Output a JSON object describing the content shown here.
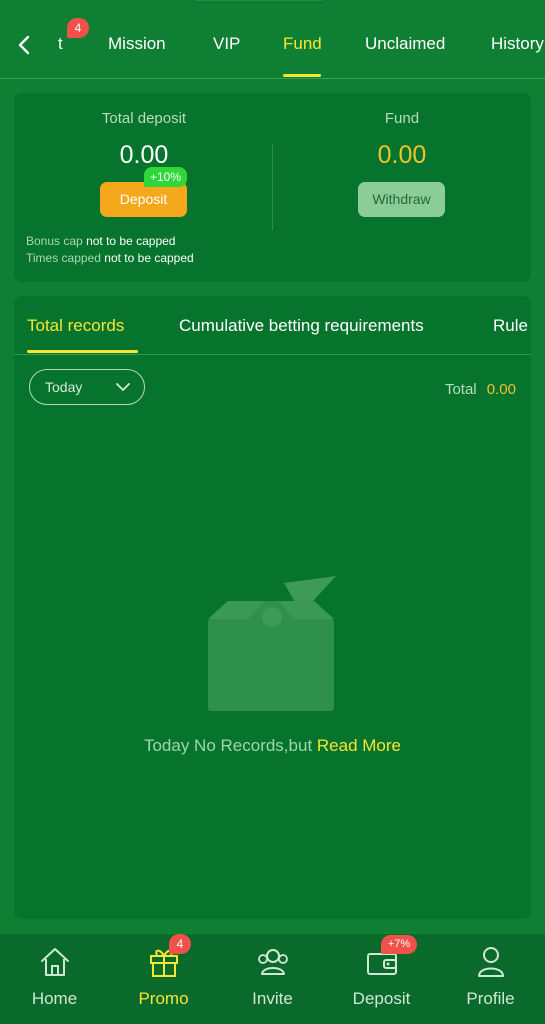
{
  "topbar": {
    "tabs": [
      {
        "label": "t",
        "badge": "4"
      },
      {
        "label": "Mission"
      },
      {
        "label": "VIP"
      },
      {
        "label": "Fund",
        "active": true
      },
      {
        "label": "Unclaimed"
      },
      {
        "label": "History"
      }
    ]
  },
  "summary": {
    "deposit_label": "Total deposit",
    "deposit_amount": "0.00",
    "deposit_button": "Deposit",
    "deposit_bonus": "+10%",
    "fund_label": "Fund",
    "fund_amount": "0.00",
    "withdraw_button": "Withdraw",
    "bonus_cap_label": "Bonus cap",
    "bonus_cap_value": "not to be capped",
    "times_capped_label": "Times capped",
    "times_capped_value": "not to be capped"
  },
  "records": {
    "tabs": [
      "Total records",
      "Cumulative betting requirements",
      "Rule"
    ],
    "filter_value": "Today",
    "total_label": "Total",
    "total_value": "0.00",
    "empty_text": "Today No Records,but",
    "empty_link": "Read More"
  },
  "bottom_nav": {
    "items": [
      {
        "label": "Home",
        "icon": "home-icon"
      },
      {
        "label": "Promo",
        "icon": "gift-icon",
        "badge": "4",
        "active": true
      },
      {
        "label": "Invite",
        "icon": "invite-icon"
      },
      {
        "label": "Deposit",
        "icon": "wallet-icon",
        "badge": "+7%"
      },
      {
        "label": "Profile",
        "icon": "profile-icon"
      }
    ]
  },
  "colors": {
    "background": "#0f7f34",
    "card": "#06742c",
    "accent_yellow": "#f7e536",
    "amount_gold": "#f2c12e",
    "deposit_orange": "#f6a81c",
    "badge_red": "#f0524a",
    "bonus_green": "#2fd73a"
  }
}
